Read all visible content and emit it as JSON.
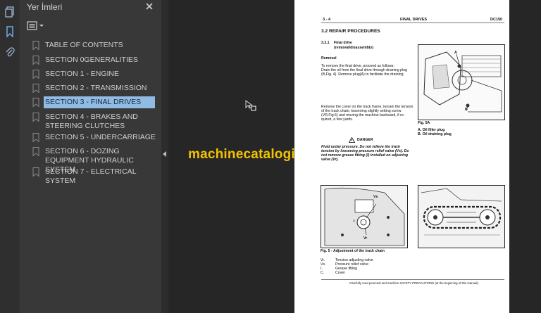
{
  "sidebar": {
    "title": "Yer İmleri",
    "items": [
      {
        "label": "TABLE OF CONTENTS"
      },
      {
        "label": "SECTION 0GENERALITIES"
      },
      {
        "label": "SECTION 1 - ENGINE"
      },
      {
        "label": "SECTION 2 - TRANSMISSION"
      },
      {
        "label": "SECTION 3 - FINAL DRIVES"
      },
      {
        "label": "SECTION 4 - BRAKES AND STEERING CLUTCHES"
      },
      {
        "label": "SECTION 5 - UNDERCARRIAGE"
      },
      {
        "label": "SECTION 6 - DOZING EQUIPMENT HYDRAULIC SYSTEM"
      },
      {
        "label": "SECTION 7 - ELECTRICAL SYSTEM"
      }
    ]
  },
  "watermark": "machinecatalogic.com",
  "page": {
    "header_left": "3 - 4",
    "header_center": "FINAL DRIVES",
    "header_right": "DC150",
    "section_title": "3.2   REPAIR PROCEDURES",
    "sub_number": "3.2.1",
    "sub_title": "Final drive",
    "sub_title2": "(removal/disassembly)",
    "removal_heading": "Removal",
    "removal_text1": "To remove the final drive, proceed as follows:",
    "removal_text2": "Drain the oil from the final drive through draining plug",
    "removal_text3": "(B,Fig. 4). Remove plug(A) to facilitate the draining.",
    "cover_text1": "Remove the cover on the track frame, loosen the tension",
    "cover_text2": "of the track chain, loosening slightly setting screw",
    "cover_text3": "(VR,Fig.5) and moving the machine backward, if re-",
    "cover_text4": "quired, a few yards.",
    "danger_label": "DANGER",
    "danger_text1": "Fluid under pressure. Do not relieve the track",
    "danger_text2": "tension by loosening pressure relief valve (Vs). Do",
    "danger_text3": "not remove grease fitting (I) installed on adjusting",
    "danger_text4": "valve (Vr).",
    "fig5a_caption": "Fig. 5A",
    "fig5a_A": "A. Oil filler plug",
    "fig5a_B": "B. Oil draining plug",
    "fig_label_A": "A",
    "fig_label_B": "B",
    "fig5_caption": "Fig. 5 - Adjustment of the track chain",
    "fig5_label_vs": "Vs",
    "fig5_label_vr": "Vr",
    "fig5_label_i": "I",
    "legend": [
      {
        "key": "Vr.",
        "val": "Tension adjusting valve"
      },
      {
        "key": "Vs.",
        "val": "Pressure relief valve"
      },
      {
        "key": "I.",
        "val": "Grease fitting"
      },
      {
        "key": "C.",
        "val": "Cover"
      }
    ],
    "footer": "Carefully read personal and machine SAFETY PRECAUTIONS (at the beginning of this manual)"
  }
}
